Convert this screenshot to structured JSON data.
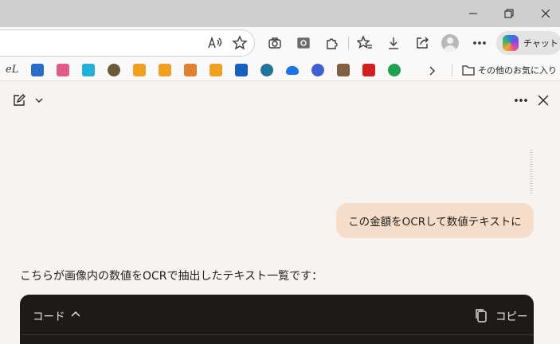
{
  "toolbar": {
    "copilot_label": "チャット"
  },
  "bookmarks": {
    "first_label": "eL",
    "folder_label": "その他のお気に入り",
    "favicon_colors": [
      "#2a6cc7",
      "#e05a8a",
      "#20b0d8",
      "#6b5a3a",
      "#f0a020",
      "#f0a020",
      "#e08030",
      "#f0a020",
      "#1560c0",
      "#21759b",
      "#1a73e8",
      "#4060d0",
      "#806040",
      "#d02020",
      "#22a050"
    ]
  },
  "chat": {
    "user_message": "この金額をOCRして数値テキストに",
    "reply_intro": "こちらが画像内の数値をOCRで抽出したテキスト一覧です：",
    "code_label": "コード",
    "copy_label": "コピー"
  },
  "colors": {
    "user_bubble": "#f5ddc9",
    "code_bg": "#1d1a17",
    "pane_bg": "#f7f3f0"
  }
}
